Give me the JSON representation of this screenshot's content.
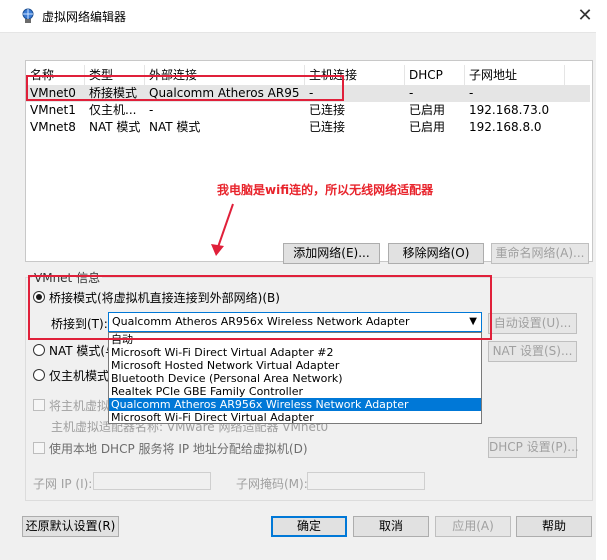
{
  "window": {
    "title": "虚拟网络编辑器",
    "close_glyph": "✕",
    "title_icon": "network-editor-icon"
  },
  "table": {
    "headers": [
      "名称",
      "类型",
      "外部连接",
      "主机连接",
      "DHCP",
      "子网地址"
    ],
    "rows": [
      {
        "name": "VMnet0",
        "type": "桥接模式",
        "external": "Qualcomm Atheros AR956x ...",
        "host": "-",
        "dhcp": "-",
        "subnet": "-"
      },
      {
        "name": "VMnet1",
        "type": "仅主机...",
        "external": "-",
        "host": "已连接",
        "dhcp": "已启用",
        "subnet": "192.168.73.0"
      },
      {
        "name": "VMnet8",
        "type": "NAT 模式",
        "external": "NAT 模式",
        "host": "已连接",
        "dhcp": "已启用",
        "subnet": "192.168.8.0"
      }
    ]
  },
  "annotation": {
    "text": "我电脑是wifi连的，所以无线网络适配器",
    "color": "#e8242c"
  },
  "table_buttons": {
    "add": "添加网络(E)...",
    "remove": "移除网络(O)",
    "rename": "重命名网络(A)..."
  },
  "vmnet_info": {
    "legend": "VMnet 信息",
    "bridged_label": "桥接模式(将虚拟机直接连接到外部网络)(B)",
    "bridged_to_label": "桥接到(T):",
    "bridged_to_value": "Qualcomm Atheros AR956x Wireless Network Adapter",
    "auto_settings": "自动设置(U)...",
    "nat_label": "NAT 模式(与",
    "nat_settings": "NAT 设置(S)...",
    "hostonly_label": "仅主机模式",
    "connect_host_label": "将主机虚拟",
    "connect_host_sub": "主机虚拟适配器名称: VMware 网络适配器 VMnet0",
    "dhcp_label": "使用本地 DHCP 服务将 IP 地址分配给虚拟机(D)",
    "dhcp_settings": "DHCP 设置(P)...",
    "subnet_ip_label": "子网 IP (I):",
    "subnet_mask_label": "子网掩码(M):"
  },
  "dropdown": {
    "options": [
      "自动",
      "Microsoft Wi-Fi Direct Virtual Adapter #2",
      "Microsoft Hosted Network Virtual Adapter",
      "Bluetooth Device (Personal Area Network)",
      "Realtek PCIe GBE Family Controller",
      "Qualcomm Atheros AR956x Wireless Network Adapter",
      "Microsoft Wi-Fi Direct Virtual Adapter"
    ],
    "highlighted_index": 5
  },
  "footer": {
    "restore": "还原默认设置(R)",
    "ok": "确定",
    "cancel": "取消",
    "apply": "应用(A)",
    "help": "帮助"
  }
}
